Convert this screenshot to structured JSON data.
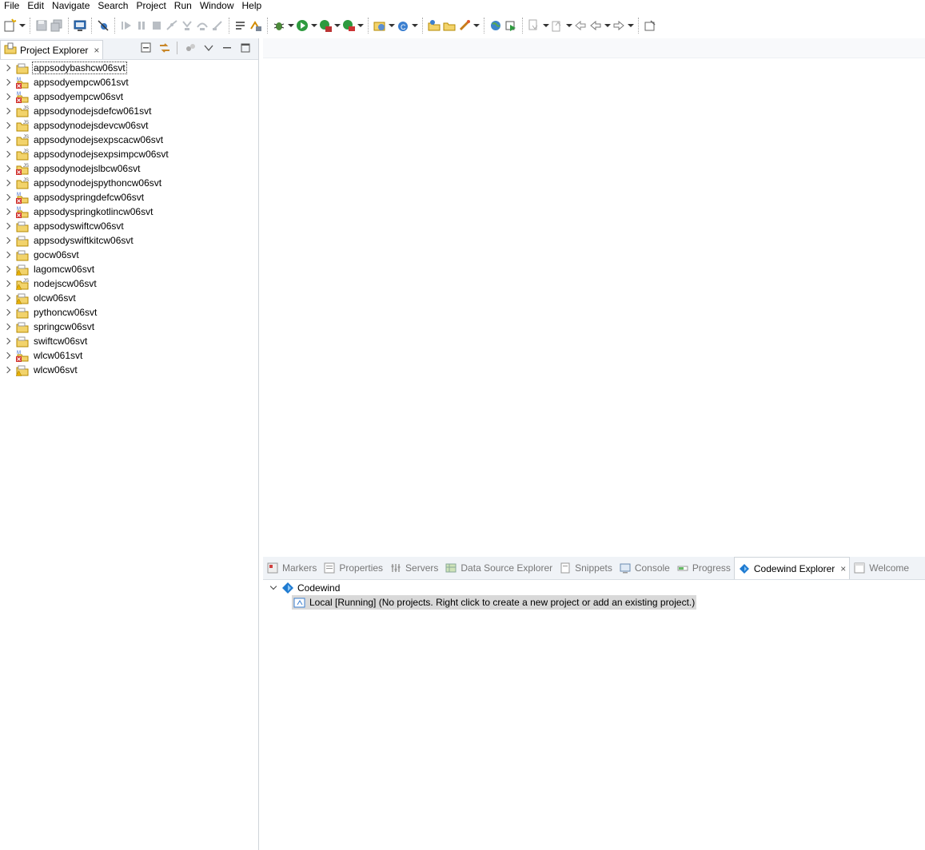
{
  "menu": [
    "File",
    "Edit",
    "Navigate",
    "Search",
    "Project",
    "Run",
    "Window",
    "Help"
  ],
  "project_explorer": {
    "tab_label": "Project Explorer",
    "close_symbol": "×",
    "projects": [
      {
        "name": "appsodybashcw06svt",
        "icon": "folder-icon",
        "badge": "none"
      },
      {
        "name": "appsodyempcw061svt",
        "icon": "maven-project-error-icon",
        "badge": "error"
      },
      {
        "name": "appsodyempcw06svt",
        "icon": "maven-project-error-icon",
        "badge": "error"
      },
      {
        "name": "appsodynodejsdefcw061svt",
        "icon": "nodejs-folder-icon",
        "badge": "js"
      },
      {
        "name": "appsodynodejsdevcw06svt",
        "icon": "nodejs-folder-icon",
        "badge": "js"
      },
      {
        "name": "appsodynodejsexpscacw06svt",
        "icon": "nodejs-folder-icon",
        "badge": "js"
      },
      {
        "name": "appsodynodejsexpsimpcw06svt",
        "icon": "nodejs-folder-icon",
        "badge": "js"
      },
      {
        "name": "appsodynodejslbcw06svt",
        "icon": "nodejs-folder-error-icon",
        "badge": "js-error"
      },
      {
        "name": "appsodynodejspythoncw06svt",
        "icon": "nodejs-folder-icon",
        "badge": "js"
      },
      {
        "name": "appsodyspringdefcw06svt",
        "icon": "maven-project-error-icon",
        "badge": "error"
      },
      {
        "name": "appsodyspringkotlincw06svt",
        "icon": "maven-project-error-icon",
        "badge": "error"
      },
      {
        "name": "appsodyswiftcw06svt",
        "icon": "folder-icon",
        "badge": "none"
      },
      {
        "name": "appsodyswiftkitcw06svt",
        "icon": "folder-icon",
        "badge": "none"
      },
      {
        "name": "gocw06svt",
        "icon": "folder-icon",
        "badge": "none"
      },
      {
        "name": "lagomcw06svt",
        "icon": "folder-warning-icon",
        "badge": "warning"
      },
      {
        "name": "nodejscw06svt",
        "icon": "nodejs-folder-warning-icon",
        "badge": "js-warning"
      },
      {
        "name": "olcw06svt",
        "icon": "maven-project-warning-icon",
        "badge": "warning"
      },
      {
        "name": "pythoncw06svt",
        "icon": "folder-icon",
        "badge": "none"
      },
      {
        "name": "springcw06svt",
        "icon": "maven-project-icon",
        "badge": "none"
      },
      {
        "name": "swiftcw06svt",
        "icon": "folder-icon",
        "badge": "none"
      },
      {
        "name": "wlcw061svt",
        "icon": "maven-project-error-icon",
        "badge": "error"
      },
      {
        "name": "wlcw06svt",
        "icon": "maven-project-warning-icon",
        "badge": "warning"
      }
    ]
  },
  "bottom_tabs": [
    {
      "label": "Markers",
      "icon": "markers-icon",
      "active": false
    },
    {
      "label": "Properties",
      "icon": "properties-icon",
      "active": false
    },
    {
      "label": "Servers",
      "icon": "servers-icon",
      "active": false
    },
    {
      "label": "Data Source Explorer",
      "icon": "data-source-icon",
      "active": false
    },
    {
      "label": "Snippets",
      "icon": "snippets-icon",
      "active": false
    },
    {
      "label": "Console",
      "icon": "console-icon",
      "active": false
    },
    {
      "label": "Progress",
      "icon": "progress-icon",
      "active": false
    },
    {
      "label": "Codewind Explorer",
      "icon": "codewind-icon",
      "active": true
    },
    {
      "label": "Welcome",
      "icon": "welcome-icon",
      "active": false
    }
  ],
  "codewind": {
    "root_label": "Codewind",
    "local_label": "Local [Running] (No projects. Right click to create a new project or add an existing project.)"
  },
  "colors": {
    "accent_blue": "#1f7bd1",
    "error_red": "#d0312d",
    "warning_yellow": "#e8b000",
    "folder_yellow": "#f2d36b",
    "selection_grey": "#d9d9d9"
  }
}
